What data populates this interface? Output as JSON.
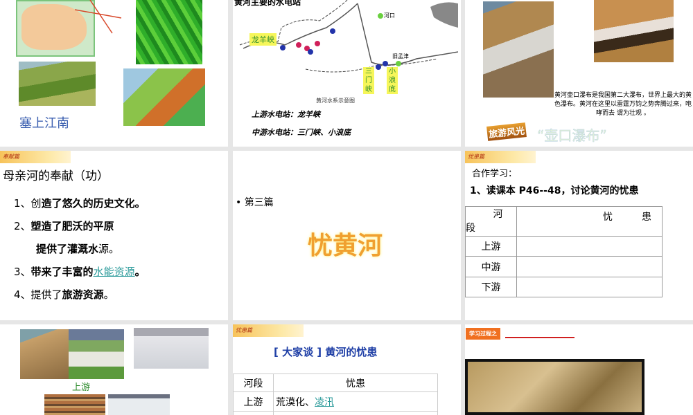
{
  "slides": [
    {
      "caption": "塞上江南"
    },
    {
      "title": "黄河主要的水电站",
      "labels": {
        "longyangxia": "龙羊峡",
        "sanmenxia": "三\n门\n峡",
        "xiaolangdi": "小\n浪\n底",
        "hekou": "河口",
        "jiumengjin": "旧孟津",
        "map_caption": "黄河水系示意图"
      },
      "line1": "上游水电站：龙羊峡",
      "line2": "中游水电站：三门峡、小浪底"
    },
    {
      "description": "黄河壶口瀑布是我国第二大瀑布，世界上最大的黄色瀑布。黄河在这里以雷霆万钧之势奔腾过来，咆哮而去 谓为壮观 。",
      "badge": "旅游风光",
      "title": "“壶口瀑布”"
    },
    {
      "tag": "奉献篇",
      "title": "母亲河的奉献（功）",
      "items": [
        {
          "num": "1、",
          "plain": "创",
          "bold": "造了悠久的历史文化。"
        },
        {
          "num": "2、",
          "bold": "塑造了肥沃的平原"
        },
        {
          "bold": "提供了灌溉水",
          "plain": "源。"
        },
        {
          "num": "3、",
          "bold": "带来了丰富的",
          "link": "水能资源",
          "tail": "。"
        },
        {
          "num": "4、",
          "plain": "提供了",
          "bold": "旅游资源",
          "tail": "。"
        }
      ]
    },
    {
      "bullet": "第三篇",
      "title": "忧黄河"
    },
    {
      "tag": "忧患篇",
      "intro": "合作学习：",
      "task": "1、读课本 P46--48，讨论黄河的忧患",
      "table": {
        "h1a": "河",
        "h1b": "段",
        "h2a": "忧",
        "h2b": "患",
        "rows": [
          "上游",
          "中游",
          "下游"
        ]
      }
    },
    {
      "caption": "上游"
    },
    {
      "tag": "忧患篇",
      "title": "[ 大家谈 ] 黄河的忧患",
      "table": {
        "headers": [
          "河段",
          "忧患"
        ],
        "row1": {
          "seg": "上游",
          "text": "荒漠化、",
          "link": "凌汛"
        }
      }
    },
    {
      "badge": "学习过程之"
    }
  ],
  "colors": {
    "accent_blue": "#1f3fa6",
    "link": "#2a9a9a",
    "title_orange": "#f0a030"
  }
}
